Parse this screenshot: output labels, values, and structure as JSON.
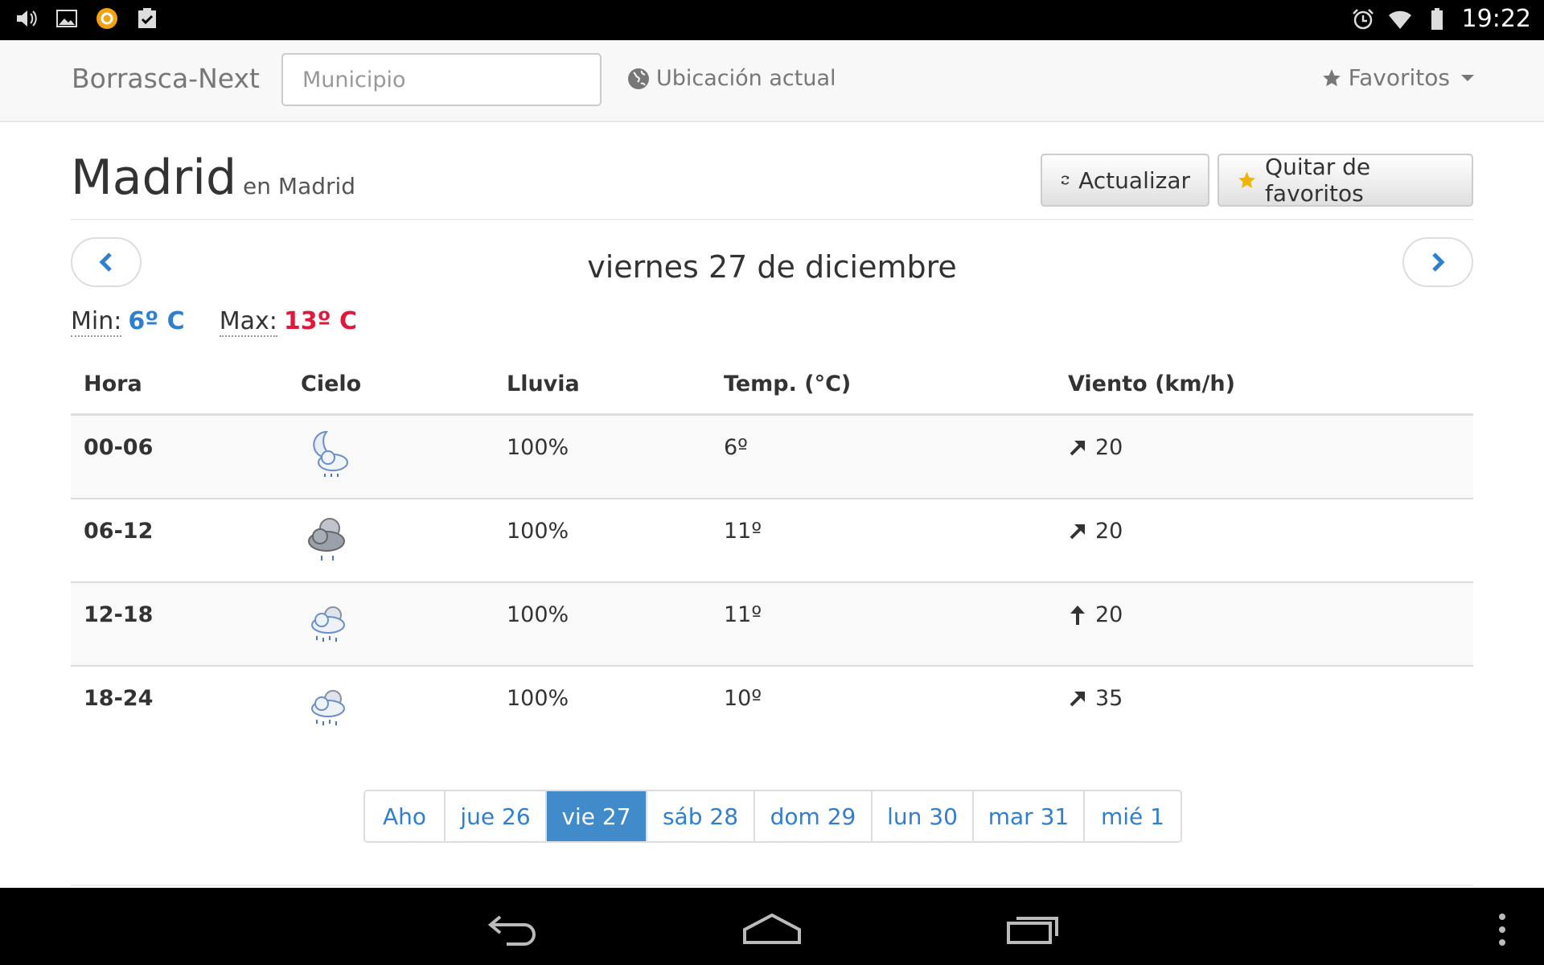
{
  "status_bar": {
    "time": "19:22",
    "left_icons": [
      "volume-icon",
      "image-icon",
      "app-icon",
      "clipboard-check-icon"
    ],
    "right_icons": [
      "alarm-icon",
      "wifi-icon",
      "battery-icon"
    ]
  },
  "navbar": {
    "brand": "Borrasca-Next",
    "search_placeholder": "Municipio",
    "locate_label": "Ubicación actual",
    "favorites_label": "Favoritos"
  },
  "header": {
    "city": "Madrid",
    "region": "en Madrid",
    "refresh_label": "Actualizar",
    "unfavorite_label": "Quitar de favoritos"
  },
  "day": {
    "title": "viernes 27 de diciembre",
    "min_label": "Min:",
    "min_value": "6º C",
    "max_label": "Max:",
    "max_value": "13º C"
  },
  "table": {
    "headers": [
      "Hora",
      "Cielo",
      "Lluvia",
      "Temp. (°C)",
      "Viento (km/h)"
    ],
    "rows": [
      {
        "hora": "00-06",
        "sky_icon": "night-cloud-rain-icon",
        "lluvia": "100%",
        "temp": "6º",
        "wind_dir": "northeast",
        "wind": "20"
      },
      {
        "hora": "06-12",
        "sky_icon": "storm-cloud-rain-icon",
        "lluvia": "100%",
        "temp": "11º",
        "wind_dir": "northeast",
        "wind": "20"
      },
      {
        "hora": "12-18",
        "sky_icon": "cloud-rain-icon",
        "lluvia": "100%",
        "temp": "11º",
        "wind_dir": "north",
        "wind": "20"
      },
      {
        "hora": "18-24",
        "sky_icon": "cloud-rain-icon",
        "lluvia": "100%",
        "temp": "10º",
        "wind_dir": "northeast",
        "wind": "35"
      }
    ]
  },
  "pagination": {
    "items": [
      "Aho",
      "jue 26",
      "vie 27",
      "sáb 28",
      "dom 29",
      "lun 30",
      "mar 31",
      "mié 1"
    ],
    "active": "vie 27"
  },
  "colors": {
    "min": "#2f7fd1",
    "max": "#e0193c",
    "link": "#2f7fd1",
    "active_page": "#428bca",
    "star": "#f0b400"
  }
}
